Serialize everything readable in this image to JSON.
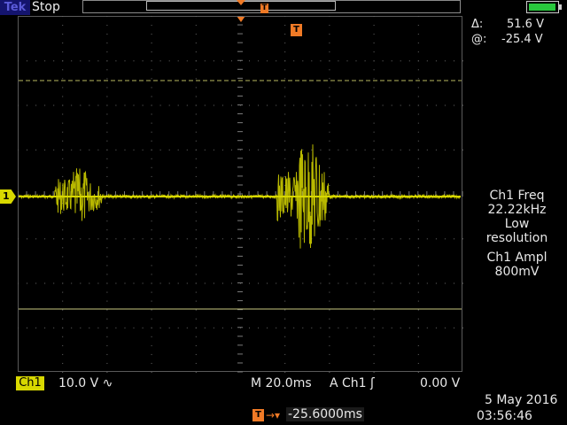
{
  "header": {
    "brand": "Tek",
    "status": "Stop"
  },
  "cursor_readout": {
    "delta_symbol": "Δ:",
    "delta_value": "51.6 V",
    "at_symbol": "@:",
    "at_value": "-25.4 V"
  },
  "channel_marker": "1",
  "measurements": {
    "freq_label": "Ch1 Freq",
    "freq_value": "22.22kHz",
    "freq_note_1": "Low",
    "freq_note_2": "resolution",
    "ampl_label": "Ch1 Ampl",
    "ampl_value": "800mV"
  },
  "bottom_bar": {
    "ch1_label": "Ch1",
    "ch1_scale": "10.0 V ∿",
    "horizontal_scale": "M 20.0ms",
    "trigger_source": "A   Ch1  ʃ",
    "trigger_level": "0.00 V",
    "delay_value": "-25.6000ms",
    "date": "5 May 2016",
    "time": "03:56:46"
  },
  "colors": {
    "trace": "#d8d800",
    "trigger": "#f07a26",
    "battery": "#28c83c",
    "brand_bg": "#14146e"
  },
  "icons": {
    "trigger_marker": "trigger-T-icon",
    "battery": "battery-icon",
    "delay": "delay-arrow-icon"
  }
}
